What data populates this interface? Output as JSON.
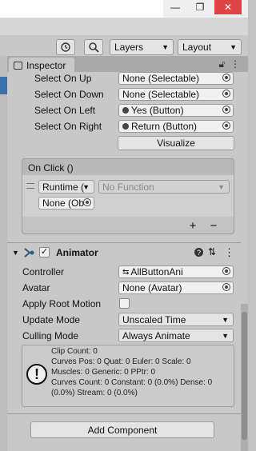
{
  "window": {
    "minimize": "—",
    "maximize": "❐",
    "close": "✕"
  },
  "toolbar": {
    "layers_label": "Layers",
    "layout_label": "Layout",
    "history_icon": "history-icon",
    "search_icon": "search-icon"
  },
  "inspector": {
    "tab_label": "Inspector"
  },
  "navigation": {
    "rows": [
      {
        "label": "Select On Up",
        "value": "None (Selectable)"
      },
      {
        "label": "Select On Down",
        "value": "None (Selectable)"
      },
      {
        "label": "Select On Left",
        "value": "Yes (Button)"
      },
      {
        "label": "Select On Right",
        "value": "Return (Button)"
      }
    ],
    "visualize_label": "Visualize"
  },
  "on_click": {
    "header": "On Click ()",
    "runtime_value": "Runtime (",
    "function_value": "No Function",
    "object_value": "None (Ob",
    "add_label": "+",
    "remove_label": "−"
  },
  "animator": {
    "title": "Animator",
    "enabled": true,
    "controller_label": "Controller",
    "controller_value": "AllButtonAni",
    "avatar_label": "Avatar",
    "avatar_value": "None (Avatar)",
    "apply_root_motion_label": "Apply Root Motion",
    "apply_root_motion": false,
    "update_mode_label": "Update Mode",
    "update_mode_value": "Unscaled Time",
    "culling_mode_label": "Culling Mode",
    "culling_mode_value": "Always Animate",
    "info": [
      "Clip Count: 0",
      "Curves Pos: 0 Quat: 0 Euler: 0 Scale: 0",
      "Muscles: 0 Generic: 0 PPtr: 0",
      "Curves Count: 0 Constant: 0 (0.0%) Dense: 0",
      "(0.0%) Stream: 0 (0.0%)"
    ]
  },
  "add_component_label": "Add Component"
}
